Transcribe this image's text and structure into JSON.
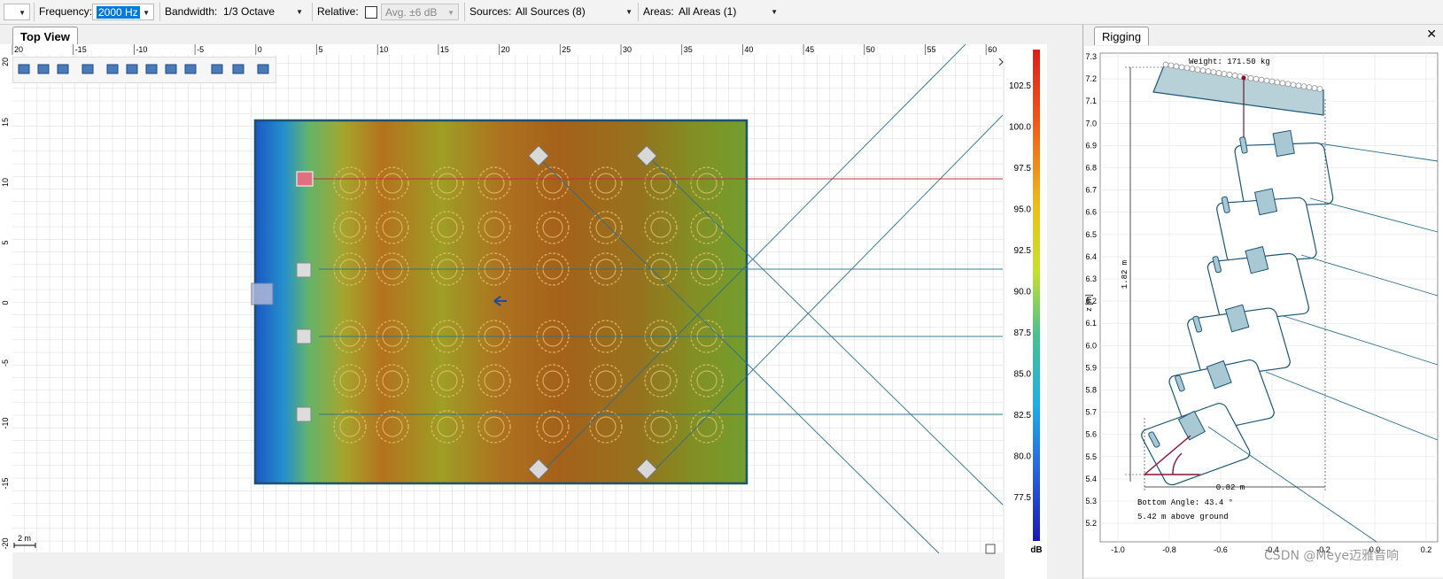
{
  "toolbar": {
    "frequency_label": "Frequency:",
    "frequency_value": "2000 Hz",
    "bandwidth_label": "Bandwidth:",
    "bandwidth_value": "1/3 Octave",
    "relative_label": "Relative:",
    "relative_checked": false,
    "avg_placeholder": "Avg. ±6 dB",
    "sources_label": "Sources:",
    "sources_value": "All Sources (8)",
    "areas_label": "Areas:",
    "areas_value": "All Areas (1)"
  },
  "top_view": {
    "tab_title": "Top View",
    "scale_label": "2 m",
    "ruler_x": [
      "20",
      "-15",
      "-10",
      "-5",
      "0",
      "5",
      "10",
      "15",
      "20",
      "25",
      "30",
      "35",
      "40",
      "45",
      "50",
      "55",
      "60"
    ],
    "ruler_y": [
      "20",
      "15",
      "10",
      "5",
      "0",
      "-5",
      "-10",
      "-15",
      "-20"
    ],
    "tools": [
      "zoom-in-icon",
      "zoom-out-icon",
      "zoom-fit-icon",
      "select-area-icon",
      "rectangle-icon",
      "arc-icon",
      "sector-icon",
      "trapezoid-icon",
      "polygon-icon",
      "curve-icon",
      "measure-icon",
      "probe-icon"
    ]
  },
  "colorbar": {
    "labels": [
      "102.5",
      "100.0",
      "97.5",
      "95.0",
      "92.5",
      "90.0",
      "87.5",
      "85.0",
      "82.5",
      "80.0",
      "77.5"
    ],
    "unit": "dB"
  },
  "rigging": {
    "tab_title": "Rigging",
    "close_label": "✕",
    "weight_text": "Weight: 171.50 kg",
    "bottom_angle_text": "Bottom Angle: 43.4 °",
    "above_ground_text": "5.42 m above ground",
    "height_dim": "1.82 m",
    "width_dim": "0.82 m",
    "z_axis_label": "z [m]",
    "z_ticks": [
      "7.3",
      "7.2",
      "7.1",
      "7.0",
      "6.9",
      "6.8",
      "6.7",
      "6.6",
      "6.5",
      "6.4",
      "6.3",
      "6.2",
      "6.1",
      "6.0",
      "5.9",
      "5.8",
      "5.7",
      "5.6",
      "5.5",
      "5.4",
      "5.3",
      "5.2"
    ],
    "x_ticks": [
      "-1.0",
      "-0.8",
      "-0.6",
      "-0.4",
      "-0.2",
      "0.0",
      "0.2"
    ]
  },
  "watermark": "CSDN @Meye迈雅音响",
  "colors": {
    "accent": "#0078d7",
    "grid": "#c8c8c8",
    "room_border": "#2a5f7a",
    "ray": "#2a6f8f"
  }
}
